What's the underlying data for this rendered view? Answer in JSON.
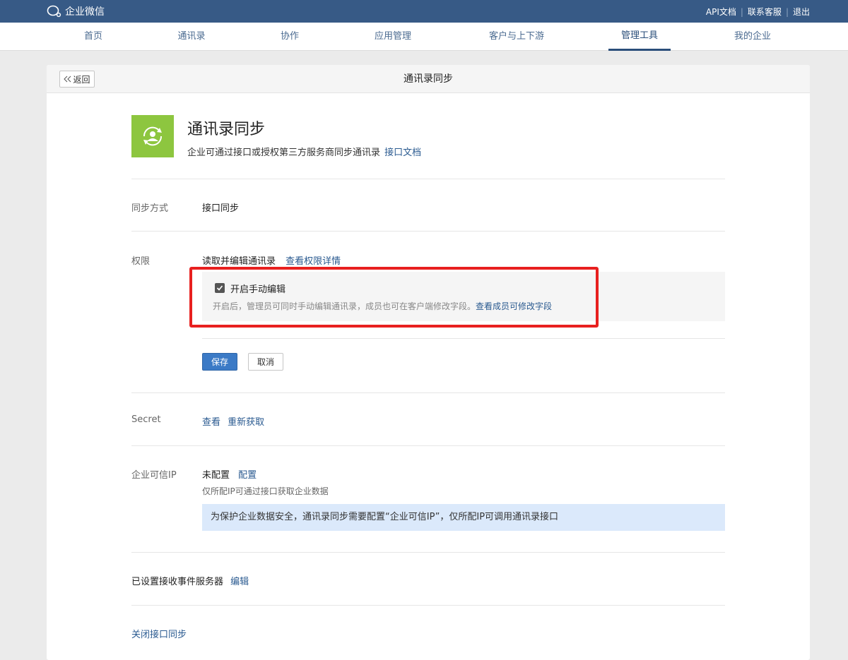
{
  "topbar": {
    "logo_text": "企业微信",
    "links": [
      "API文档",
      "联系客服",
      "退出"
    ]
  },
  "nav": {
    "items": [
      "首页",
      "通讯录",
      "协作",
      "应用管理",
      "客户与上下游",
      "管理工具",
      "我的企业"
    ],
    "active": "管理工具"
  },
  "header": {
    "back_label": "返回",
    "title": "通讯录同步"
  },
  "app": {
    "title": "通讯录同步",
    "description": "企业可通过接口或授权第三方服务商同步通讯录",
    "doc_link": "接口文档"
  },
  "sync_method": {
    "label": "同步方式",
    "value": "接口同步"
  },
  "permission": {
    "label": "权限",
    "value": "读取并编辑通讯录",
    "details_link": "查看权限详情",
    "checkbox_label": "开启手动编辑",
    "checkbox_checked": true,
    "hint": "开启后，管理员可同时手动编辑通讯录，成员也可在客户端修改字段。",
    "hint_link": "查看成员可修改字段",
    "save_label": "保存",
    "cancel_label": "取消"
  },
  "secret": {
    "label": "Secret",
    "view_link": "查看",
    "refresh_link": "重新获取"
  },
  "trusted_ip": {
    "label": "企业可信IP",
    "status": "未配置",
    "config_link": "配置",
    "note": "仅所配IP可通过接口获取企业数据",
    "info": "为保护企业数据安全，通讯录同步需要配置“企业可信IP”，仅所配IP可调用通讯录接口"
  },
  "event_server": {
    "label": "已设置接收事件服务器",
    "edit_link": "编辑"
  },
  "close_sync_link": "关闭接口同步",
  "colors": {
    "topbar": "#375a86",
    "link": "#2a5a90",
    "app_icon": "#8dc63f",
    "highlight": "#e8201f",
    "primary_button": "#3b7ac6",
    "info_box": "#dbe9fb"
  }
}
